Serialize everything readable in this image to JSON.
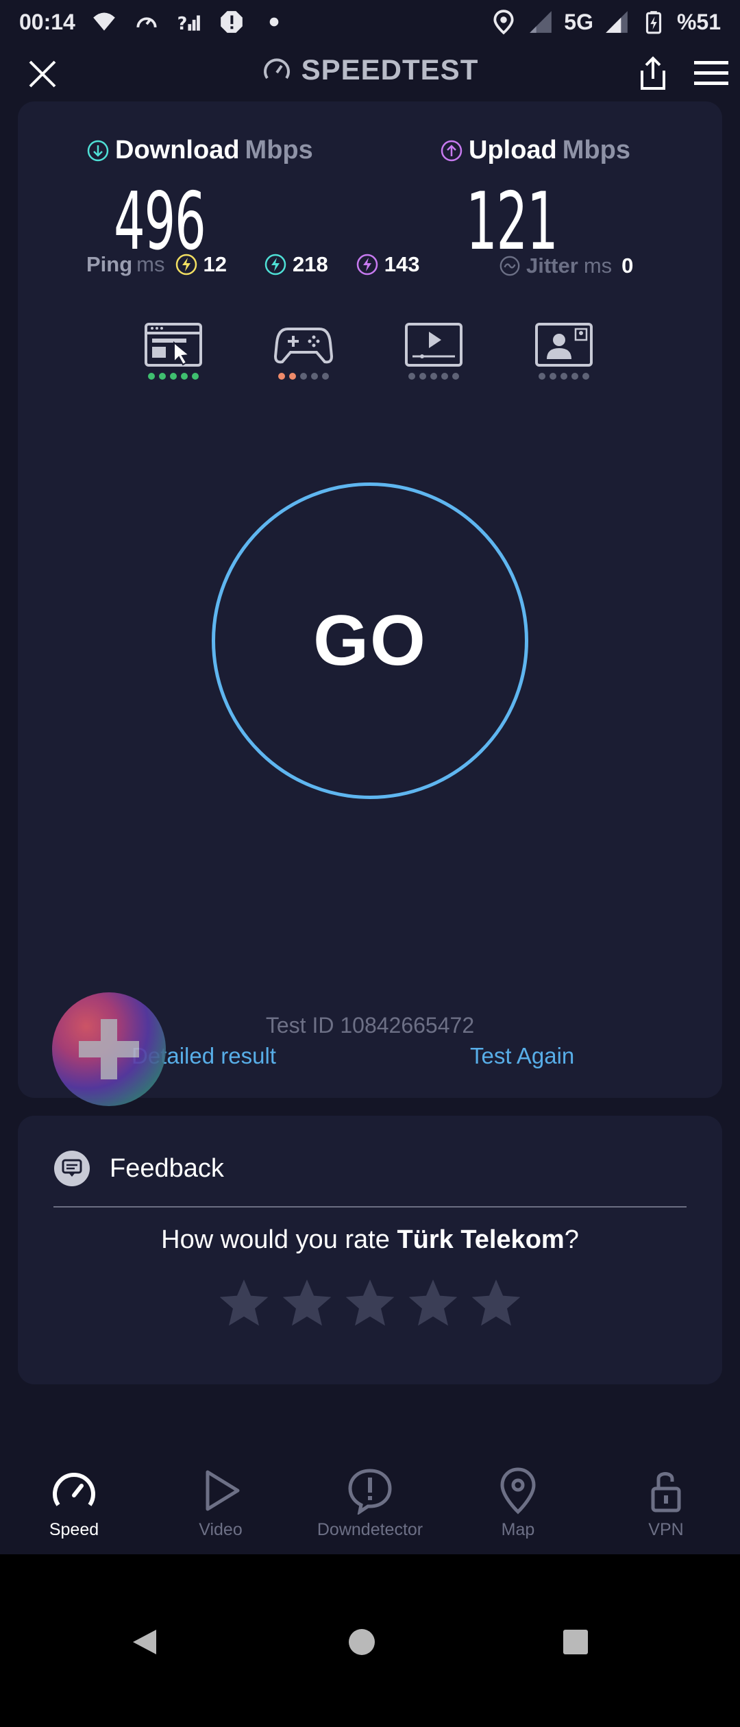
{
  "status_bar": {
    "time": "00:14",
    "network": "5G",
    "battery": "%51"
  },
  "app": {
    "title": "SPEEDTEST"
  },
  "results": {
    "download_label": "Download",
    "download_unit": "Mbps",
    "download_value": "496",
    "upload_label": "Upload",
    "upload_unit": "Mbps",
    "upload_value": "121",
    "ping_label": "Ping",
    "ping_unit": "ms",
    "ping_idle": "12",
    "ping_download": "218",
    "ping_upload": "143",
    "jitter_label": "Jitter",
    "jitter_unit": "ms",
    "jitter_value": "0"
  },
  "quality": [
    {
      "name": "browsing",
      "level": 5,
      "max": 5,
      "color": "#3fbf6f"
    },
    {
      "name": "gaming",
      "level": 2,
      "max": 5,
      "color": "#ef8a6a"
    },
    {
      "name": "streaming",
      "level": 0,
      "max": 5,
      "color": "#5f6377"
    },
    {
      "name": "video-calls",
      "level": 0,
      "max": 5,
      "color": "#5f6377"
    }
  ],
  "go": {
    "label": "GO"
  },
  "test": {
    "id_text": "Test ID 10842665472",
    "detailed_result": "Detailed result",
    "test_again": "Test Again"
  },
  "feedback": {
    "title": "Feedback",
    "question_prefix": "How would you rate ",
    "provider": "Türk Telekom",
    "question_suffix": "?",
    "rating": 0,
    "max_rating": 5
  },
  "nav": {
    "speed": "Speed",
    "video": "Video",
    "downdetector": "Downdetector",
    "map": "Map",
    "vpn": "VPN"
  },
  "colors": {
    "accent_blue": "#5fb6f0",
    "link_blue": "#58aee8",
    "download_icon": "#4fe0d6",
    "upload_icon": "#c77af0",
    "ping_idle": "#f2df62",
    "ping_download": "#4fe0d6",
    "ping_upload": "#c77af0",
    "card_bg": "#1b1d33",
    "page_bg": "#141526"
  }
}
